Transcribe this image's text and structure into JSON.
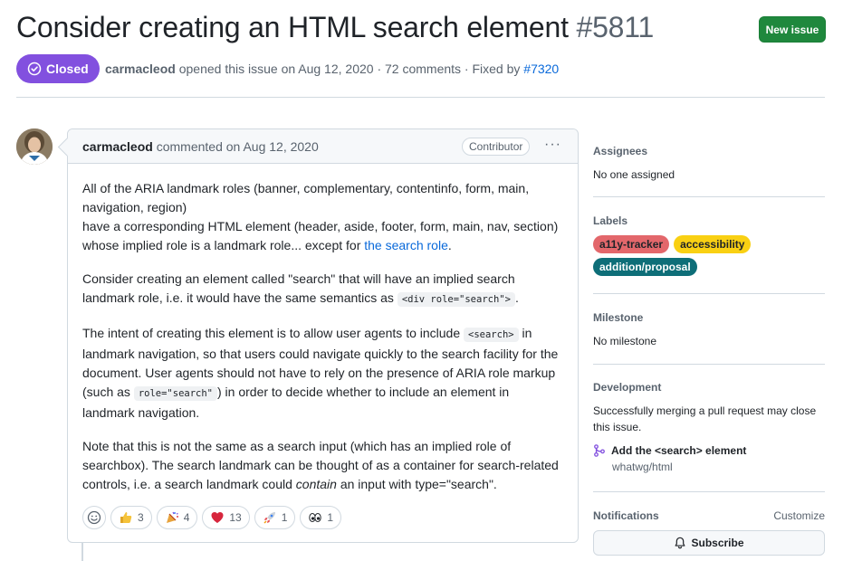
{
  "issue": {
    "title": "Consider creating an HTML search element",
    "number": "#5811",
    "state": "Closed",
    "author": "carmacleod",
    "meta_text": " opened this issue on Aug 12, 2020 · 72 comments · Fixed by ",
    "fixed_by": "#7320"
  },
  "header": {
    "new_issue_label": "New issue"
  },
  "comment": {
    "author": "carmacleod",
    "action": " commented on Aug 12, 2020",
    "role_badge": "Contributor",
    "menu": "···",
    "p1_a": "All of the ARIA landmark roles (banner, complementary, contentinfo, form, main, navigation, region)",
    "p1_b": "have a corresponding HTML element (header, aside, footer, form, main, nav, section) whose implied role is a landmark role... except for ",
    "p1_link": "the search role",
    "p1_end": ".",
    "p2_a": "Consider creating an element called \"search\" that will have an implied search landmark role, i.e. it would have the same semantics as ",
    "p2_code": "<div role=\"search\">",
    "p2_end": ".",
    "p3_a": "The intent of creating this element is to allow user agents to include ",
    "p3_code1": "<search>",
    "p3_b": " in landmark navigation, so that users could navigate quickly to the search facility for the document. User agents should not have to rely on the presence of ARIA role markup (such as ",
    "p3_code2": "role=\"search\"",
    "p3_c": ") in order to decide whether to include an element in landmark navigation.",
    "p4_a": "Note that this is not the same as a search input (which has an implied role of searchbox). The search landmark can be thought of as a container for search-related controls, i.e. a search landmark could ",
    "p4_em": "contain",
    "p4_b": " an input with type=\"search\".",
    "reactions": [
      {
        "icon": "thumbs-up-icon",
        "count": "3"
      },
      {
        "icon": "tada-icon",
        "count": "4"
      },
      {
        "icon": "heart-icon",
        "count": "13"
      },
      {
        "icon": "rocket-icon",
        "count": "1"
      },
      {
        "icon": "eyes-icon",
        "count": "1"
      }
    ]
  },
  "sidebar": {
    "assignees": {
      "title": "Assignees",
      "value": "No one assigned"
    },
    "labels": {
      "title": "Labels",
      "items": [
        {
          "text": "a11y-tracker",
          "color": "#e3676b"
        },
        {
          "text": "accessibility",
          "color": "#f9d013"
        },
        {
          "text": "addition/proposal",
          "color": "#0e6e78"
        }
      ]
    },
    "milestone": {
      "title": "Milestone",
      "value": "No milestone"
    },
    "development": {
      "title": "Development",
      "text": "Successfully merging a pull request may close this issue.",
      "pr_title": "Add the <search> element",
      "pr_repo": "whatwg/html"
    },
    "notifications": {
      "title": "Notifications",
      "customize": "Customize",
      "subscribe": "Subscribe"
    }
  },
  "colors": {
    "closed": "#8250df",
    "new_issue": "#1f883d",
    "link": "#0969da"
  }
}
